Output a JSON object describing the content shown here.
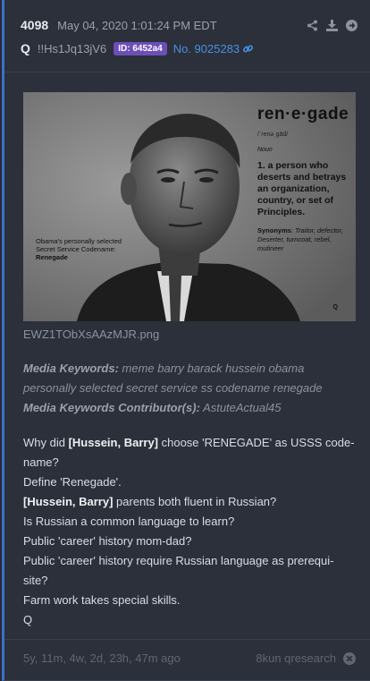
{
  "post": {
    "number": "4098",
    "date": "May 04, 2020 1:01:24 PM EDT",
    "author": "Q",
    "tripcode": "!!Hs1Jq13jV6",
    "id_badge": "ID: 6452a4",
    "post_no": "No. 9025283"
  },
  "header_icons": [
    "share-icon",
    "download-icon",
    "arrow-right-icon",
    "link-icon"
  ],
  "image": {
    "word": "ren·e·gade",
    "pronunciation": "/ˈrenəˌgād/",
    "pos": "Noun",
    "def_lines": [
      "1. a person who",
      "deserts and betrays",
      "an organization,",
      "country, or set of",
      "Principles."
    ],
    "syn_label": "Synonyms",
    "syn_lines": [
      ": Traitor, defector,",
      "Deserter, turncoat, rebel,",
      "mutineer"
    ],
    "caption_lines": [
      "Obama's personally selected",
      "Secret Service Codename:"
    ],
    "caption_bold": "Renegade",
    "corner_mark": "Q"
  },
  "filename": "EWZ1TObXsAAzMJR.png",
  "media": {
    "keywords_label": "Media Keywords:",
    "keywords": " meme barry barack hussein obama personally selected secret service ss codename renegade",
    "contrib_label": "Media Keywords Contributor(s):",
    "contrib": " AstuteActual45"
  },
  "body": {
    "l1a": "Why did ",
    "l1b": "[Hussein, Barry]",
    "l1c": " choose 'RENEGADE' as USSS code-name?",
    "l2": "Define 'Renegade'.",
    "l3a": "[Hussein, Barry]",
    "l3b": " parents both fluent in Russian?",
    "l4": "Is Russian a common language to learn?",
    "l5": "Public 'career' history mom-dad?",
    "l6": "Public 'career' history require Russian language as prerequi-site?",
    "l7": "Farm work takes special skills.",
    "l8": "Q"
  },
  "footer": {
    "ago": "5y, 11m, 4w, 2d, 23h, 47m ago",
    "source": "8kun qresearch"
  }
}
